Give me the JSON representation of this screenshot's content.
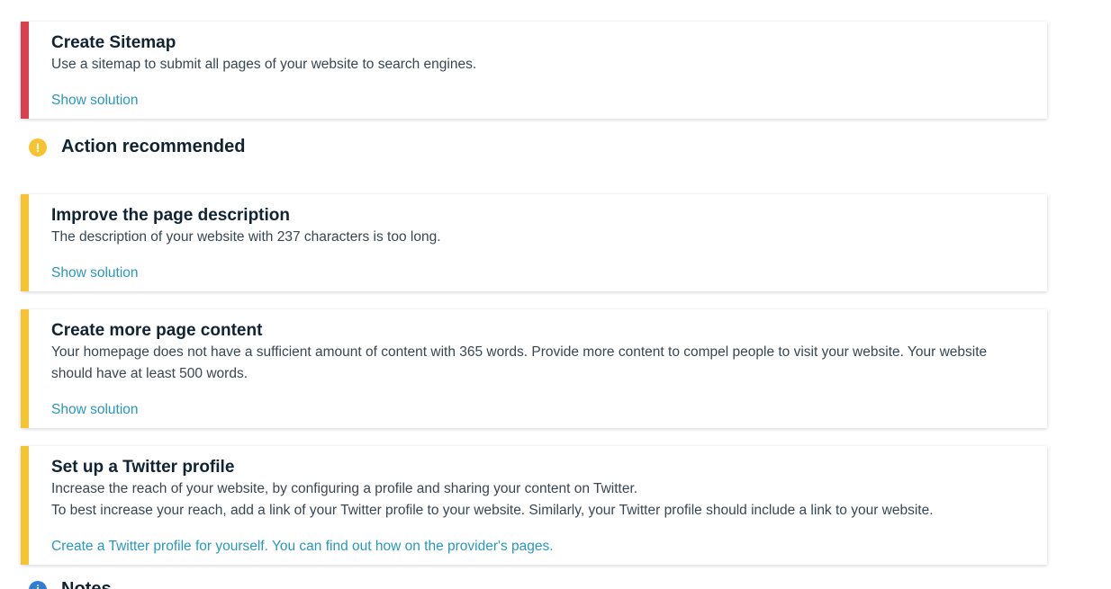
{
  "cards": [
    {
      "title": "Create Sitemap",
      "lines": [
        "Use a sitemap to submit all pages of your website to search engines."
      ],
      "link": "Show solution",
      "accent": "#d9414e"
    },
    {
      "title": "Improve the page description",
      "lines": [
        "The description of your website with 237 characters is too long."
      ],
      "link": "Show solution",
      "accent": "#f6c333"
    },
    {
      "title": "Create more page content",
      "lines": [
        "Your homepage does not have a sufficient amount of content with 365 words. Provide more content to compel people to visit your website. Your website should have at least 500 words."
      ],
      "link": "Show solution",
      "accent": "#f6c333"
    },
    {
      "title": "Set up a Twitter profile",
      "lines": [
        "Increase the reach of your website, by configuring a profile and sharing your content on Twitter.",
        "To best increase your reach, add a link of your Twitter profile to your website. Similarly, your Twitter profile should include a link to your website."
      ],
      "link": "Create a Twitter profile for yourself. You can find out how on the provider's pages.",
      "accent": "#f6c333"
    }
  ],
  "sections": {
    "recommended": {
      "title": "Action recommended",
      "icon": "exclamation-icon",
      "glyph": "!",
      "color": "#f6c333"
    },
    "next": {
      "title": "Notes",
      "icon": "info-icon",
      "glyph": "i",
      "color": "#2d7dd2"
    }
  },
  "colors": {
    "link": "#2a97bf",
    "critical": "#d9414e",
    "warning": "#f6c333"
  }
}
